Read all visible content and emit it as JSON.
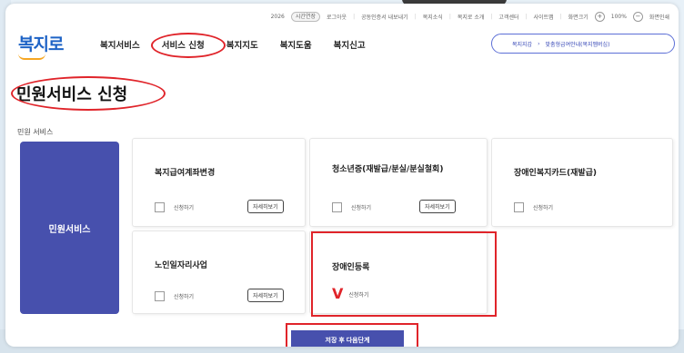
{
  "util": {
    "year": "2026",
    "login_status": "시간연장",
    "logout": "로그아웃",
    "links": [
      "공동인증서 내보내기",
      "복지소식",
      "복지로 소개",
      "고객센터",
      "사이트맵",
      "화면크기"
    ],
    "zoom_in": "+",
    "zoom": "100%",
    "zoom_out": "−",
    "reset": "화면인쇄"
  },
  "logo": "복지로",
  "gnb": [
    "복지서비스",
    "서비스 신청",
    "복지지도",
    "복지도움",
    "복지신고"
  ],
  "breadcrumb": {
    "home": "복지지갑",
    "sep": "›",
    "current": "맞춤형급여안내(복지멤버십)"
  },
  "page_title": "민원서비스 신청",
  "section_label": "민원 서비스",
  "category": "민원서비스",
  "cards": [
    {
      "title": "복지급여계좌변경",
      "check_label": "신청하기",
      "detail_label": "자세히보기"
    },
    {
      "title": "청소년증(재발급/분실/분실철회)",
      "check_label": "신청하기",
      "detail_label": "자세히보기"
    },
    {
      "title": "장애인복지카드(재발급)",
      "check_label": "신청하기"
    },
    {
      "title": "노인일자리사업",
      "check_label": "신청하기",
      "detail_label": "자세히보기"
    },
    {
      "title": "장애인등록",
      "check_label": "신청하기",
      "checked": true
    }
  ],
  "submit_label": "저장 후 다음단계",
  "colors": {
    "accent": "#4750ad",
    "highlight": "#e0242a",
    "logo": "#1e63c6"
  }
}
